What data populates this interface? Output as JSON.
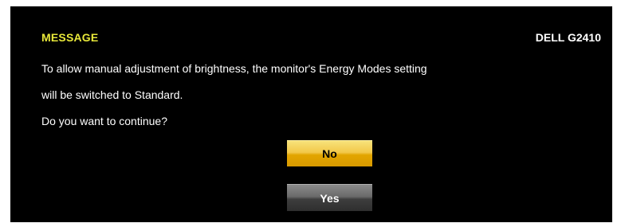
{
  "dialog": {
    "title": "MESSAGE",
    "model": "DELL G2410",
    "lines": [
      "To allow manual adjustment of brightness, the monitor's Energy Modes setting",
      "will be switched to Standard.",
      "Do you want to continue?"
    ],
    "buttons": {
      "no_label": "No",
      "yes_label": "Yes"
    }
  },
  "colors": {
    "background": "#000000",
    "title": "#e8e83a",
    "text": "#ffffff",
    "selected_button": "#e2a500",
    "unselected_button": "#3e3e3e"
  }
}
